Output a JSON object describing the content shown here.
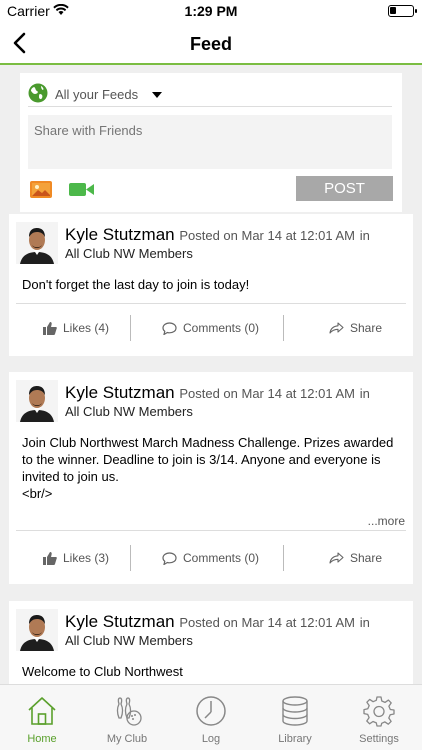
{
  "status_bar": {
    "carrier": "Carrier",
    "time": "1:29 PM"
  },
  "nav": {
    "title": "Feed"
  },
  "composer": {
    "feed_selector": "All your Feeds",
    "share_placeholder": "Share with Friends",
    "post_label": "POST"
  },
  "posts": [
    {
      "author": "Kyle Stutzman",
      "posted": "Posted on Mar 14 at 12:01 AM",
      "in_label": "in",
      "group": "All Club NW Members",
      "body": "Don't forget the last day to join is today!",
      "likes": "Likes (4)",
      "comments": "Comments (0)",
      "share": "Share"
    },
    {
      "author": "Kyle Stutzman",
      "posted": "Posted on Mar 14 at 12:01 AM",
      "in_label": "in",
      "group": "All Club NW Members",
      "body": "Join Club Northwest March Madness Challenge. Prizes awarded to the winner. Deadline to join is 3/14. Anyone and everyone is invited to join us.\n<br/>",
      "more": "...more",
      "likes": "Likes (3)",
      "comments": "Comments (0)",
      "share": "Share"
    },
    {
      "author": "Kyle Stutzman",
      "posted": "Posted on Mar 14 at 12:01 AM",
      "in_label": "in",
      "group": "All Club NW Members",
      "body": "Welcome to Club Northwest"
    }
  ],
  "tabs": [
    {
      "label": "Home",
      "icon": "home-icon",
      "active": true
    },
    {
      "label": "My Club",
      "icon": "bowling-icon",
      "active": false
    },
    {
      "label": "Log",
      "icon": "clock-icon",
      "active": false
    },
    {
      "label": "Library",
      "icon": "database-icon",
      "active": false
    },
    {
      "label": "Settings",
      "icon": "gear-icon",
      "active": false
    }
  ],
  "colors": {
    "accent": "#7bbd42",
    "tab_active": "#5aa02c",
    "post_button": "#a8a8a8"
  }
}
